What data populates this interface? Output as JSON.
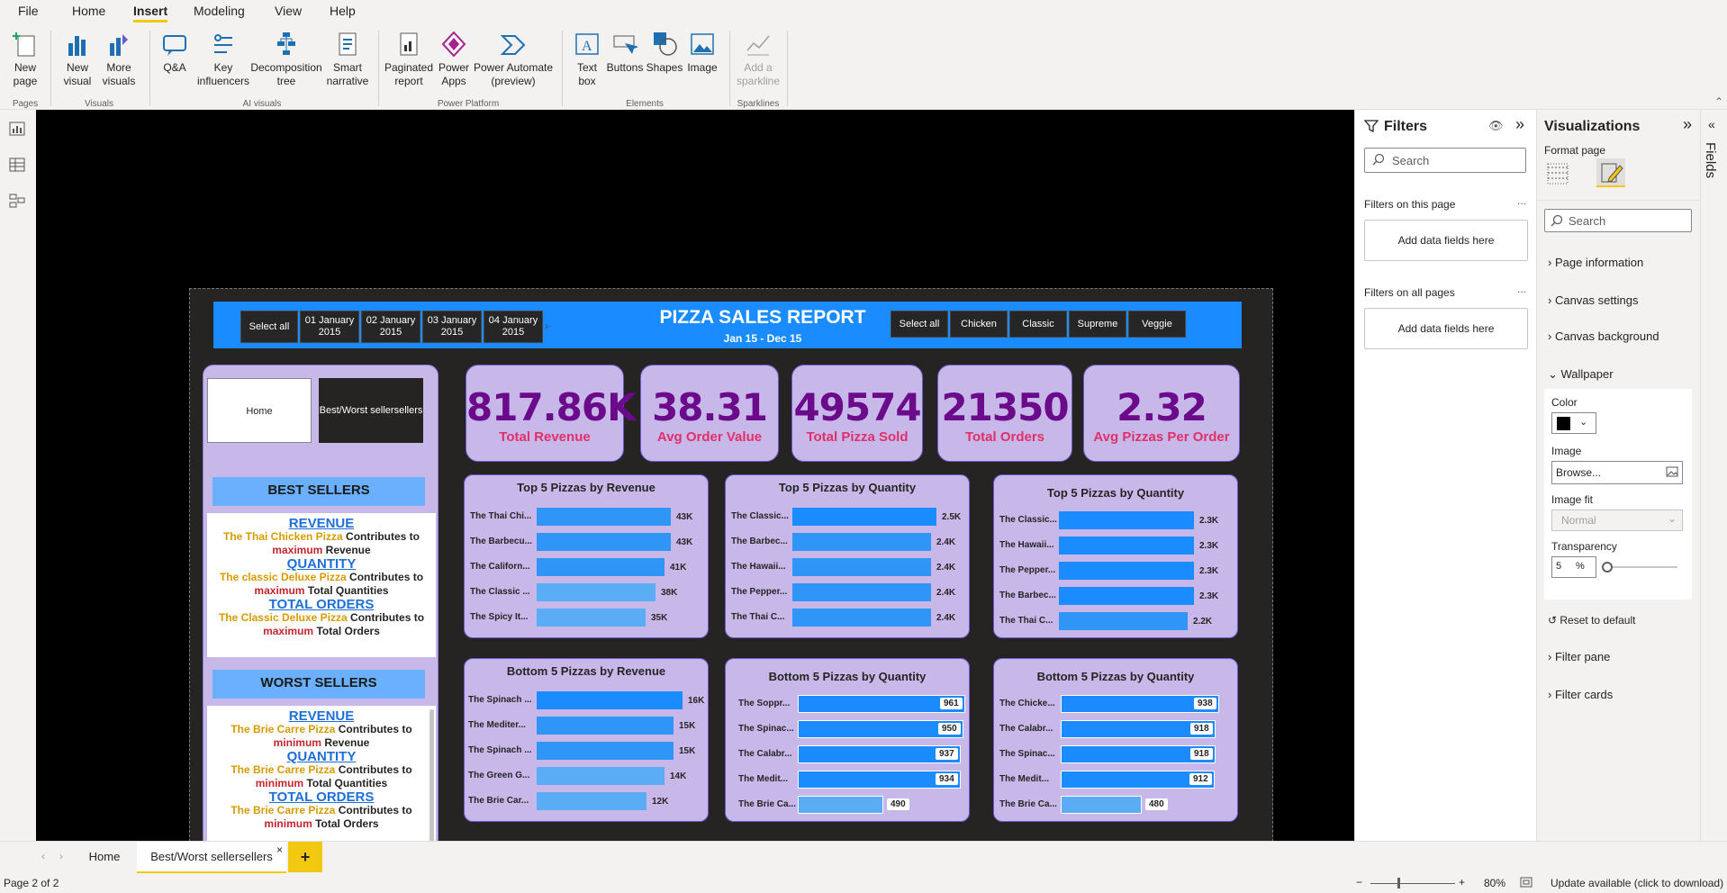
{
  "menu": {
    "file": "File",
    "home": "Home",
    "insert": "Insert",
    "modeling": "Modeling",
    "view": "View",
    "help": "Help"
  },
  "ribbon": {
    "new_page": "New\npage",
    "new_visual": "New\nvisual",
    "more_visuals": "More\nvisuals",
    "qa": "Q&A",
    "key_influencers": "Key\ninfluencers",
    "decomposition_tree": "Decomposition\ntree",
    "smart_narrative": "Smart\nnarrative",
    "paginated_report": "Paginated\nreport",
    "power_apps": "Power\nApps",
    "power_automate": "Power Automate\n(preview)",
    "text_box": "Text\nbox",
    "buttons": "Buttons",
    "shapes": "Shapes",
    "image": "Image",
    "add_sparkline": "Add a\nsparkline",
    "groups": {
      "pages": "Pages",
      "visuals": "Visuals",
      "ai_visuals": "AI visuals",
      "power_platform": "Power Platform",
      "elements": "Elements",
      "sparklines": "Sparklines"
    }
  },
  "report": {
    "title": "PIZZA SALES REPORT",
    "subtitle": "Jan 15 - Dec 15",
    "date_slicer": [
      "Select all",
      "01 January\n2015",
      "02 January\n2015",
      "03 January\n2015",
      "04 January\n2015"
    ],
    "category_slicer": [
      "Select all",
      "Chicken",
      "Classic",
      "Supreme",
      "Veggie"
    ],
    "nav": {
      "home": "Home",
      "best_worst": "Best/Worst sellersellers"
    },
    "kpis": [
      {
        "value": "817.86K",
        "label": "Total Revenue"
      },
      {
        "value": "38.31",
        "label": "Avg Order Value"
      },
      {
        "value": "49574",
        "label": "Total Pizza Sold"
      },
      {
        "value": "21350",
        "label": "Total Orders"
      },
      {
        "value": "2.32",
        "label": "Avg Pizzas Per Order"
      }
    ],
    "best_sellers": {
      "title": "BEST SELLERS",
      "revenue_h": "REVENUE",
      "revenue_pizza": "The Thai Chicken Pizza",
      "revenue_mid": " Contributes to",
      "revenue_max": "maximum",
      "revenue_end": " Revenue",
      "quantity_h": "QUANTITY",
      "quantity_pizza": "The classic Deluxe Pizza",
      "quantity_mid": " Contributes to",
      "quantity_max": "maximum",
      "quantity_end": " Total Quantities",
      "orders_h": "TOTAL ORDERS",
      "orders_pizza": "The Classic Deluxe Pizza",
      "orders_mid": " Contributes to",
      "orders_max": "maximum",
      "orders_end": " Total Orders"
    },
    "worst_sellers": {
      "title": "WORST SELLERS",
      "revenue_h": "REVENUE",
      "revenue_pizza": "The Brie Carre Pizza",
      "revenue_mid": " Contributes to",
      "revenue_min": "minimum",
      "revenue_end": " Revenue",
      "quantity_h": "QUANTITY",
      "quantity_pizza": "The Brie Carre Pizza",
      "quantity_mid": " Contributes to",
      "quantity_min": "minimum",
      "quantity_end": " Total Quantities",
      "orders_h": "TOTAL ORDERS",
      "orders_pizza": "The Brie Carre  Pizza",
      "orders_mid": " Contributes to",
      "orders_min": "minimum",
      "orders_end": " Total Orders"
    }
  },
  "chart_data": [
    {
      "type": "bar",
      "title": "Top 5 Pizzas by Revenue",
      "categories": [
        "The Thai Chi...",
        "The Barbecu...",
        "The Californ...",
        "The Classic ...",
        "The Spicy It..."
      ],
      "values": [
        43,
        43,
        41,
        38,
        35
      ],
      "labels": [
        "43K",
        "43K",
        "41K",
        "38K",
        "35K"
      ],
      "xlim": [
        0,
        45
      ]
    },
    {
      "type": "bar",
      "title": "Top 5 Pizzas by Quantity",
      "categories": [
        "The Classic...",
        "The Barbec...",
        "The Hawaii...",
        "The Pepper...",
        "The Thai C..."
      ],
      "values": [
        2.5,
        2.4,
        2.4,
        2.4,
        2.4
      ],
      "labels": [
        "2.5K",
        "2.4K",
        "2.4K",
        "2.4K",
        "2.4K"
      ],
      "xlim": [
        0,
        2.5
      ]
    },
    {
      "type": "bar",
      "title": "Top 5 Pizzas by Quantity",
      "categories": [
        "The Classic...",
        "The Hawaii...",
        "The Pepper...",
        "The Barbec...",
        "The Thai C..."
      ],
      "values": [
        2.3,
        2.3,
        2.3,
        2.3,
        2.2
      ],
      "labels": [
        "2.3K",
        "2.3K",
        "2.3K",
        "2.3K",
        "2.2K"
      ],
      "xlim": [
        0,
        2.3
      ]
    },
    {
      "type": "bar",
      "title": "Bottom 5 Pizzas by Revenue",
      "categories": [
        "The Spinach ...",
        "The Mediter...",
        "The Spinach ...",
        "The Green G...",
        "The Brie Car..."
      ],
      "values": [
        16,
        15,
        15,
        14,
        12
      ],
      "labels": [
        "16K",
        "15K",
        "15K",
        "14K",
        "12K"
      ],
      "xlim": [
        0,
        16
      ]
    },
    {
      "type": "bar",
      "title": "Bottom 5 Pizzas by Quantity",
      "categories": [
        "The Soppr...",
        "The Spinac...",
        "The Calabr...",
        "The Medit...",
        "The Brie Ca..."
      ],
      "values": [
        961,
        950,
        937,
        934,
        490
      ],
      "labels": [
        "961",
        "950",
        "937",
        "934",
        "490"
      ],
      "xlim": [
        0,
        961
      ]
    },
    {
      "type": "bar",
      "title": "Bottom 5 Pizzas by Quantity",
      "categories": [
        "The Chicke...",
        "The Calabr...",
        "The Spinac...",
        "The Medit...",
        "The Brie Ca..."
      ],
      "values": [
        938,
        918,
        918,
        912,
        480
      ],
      "labels": [
        "938",
        "918",
        "918",
        "912",
        "480"
      ],
      "xlim": [
        0,
        938
      ]
    }
  ],
  "filters": {
    "title": "Filters",
    "search": "Search",
    "on_this_page": "Filters on this page",
    "on_all_pages": "Filters on all pages",
    "add_fields": "Add data fields here",
    "dots": "..."
  },
  "viz": {
    "title": "Visualizations",
    "format_page": "Format page",
    "search": "Search",
    "sections": [
      "Page information",
      "Canvas settings",
      "Canvas background"
    ],
    "wallpaper": "Wallpaper",
    "color_label": "Color",
    "color_value": "#000000",
    "image_label": "Image",
    "browse": "Browse...",
    "image_fit_label": "Image fit",
    "image_fit_value": "Normal",
    "transparency_label": "Transparency",
    "transparency_value": "5",
    "percent": "%",
    "reset": "Reset to default",
    "filter_pane": "Filter pane",
    "filter_cards": "Filter cards",
    "fields_tab": "Fields"
  },
  "tabs": {
    "home": "Home",
    "best_worst": "Best/Worst sellersellers",
    "close": "×",
    "add": "+"
  },
  "status": {
    "page": "Page 2 of 2",
    "zoom": "80%",
    "update": "Update available (click to download)"
  },
  "colors": {
    "accent_blue": "#1a8cff",
    "card_bg": "#c8b8ea",
    "value_purple": "#6b0a8a",
    "label_pink": "#e0306a",
    "bar_dark": "#1a8cff",
    "bar_light": "#5aacf5"
  }
}
